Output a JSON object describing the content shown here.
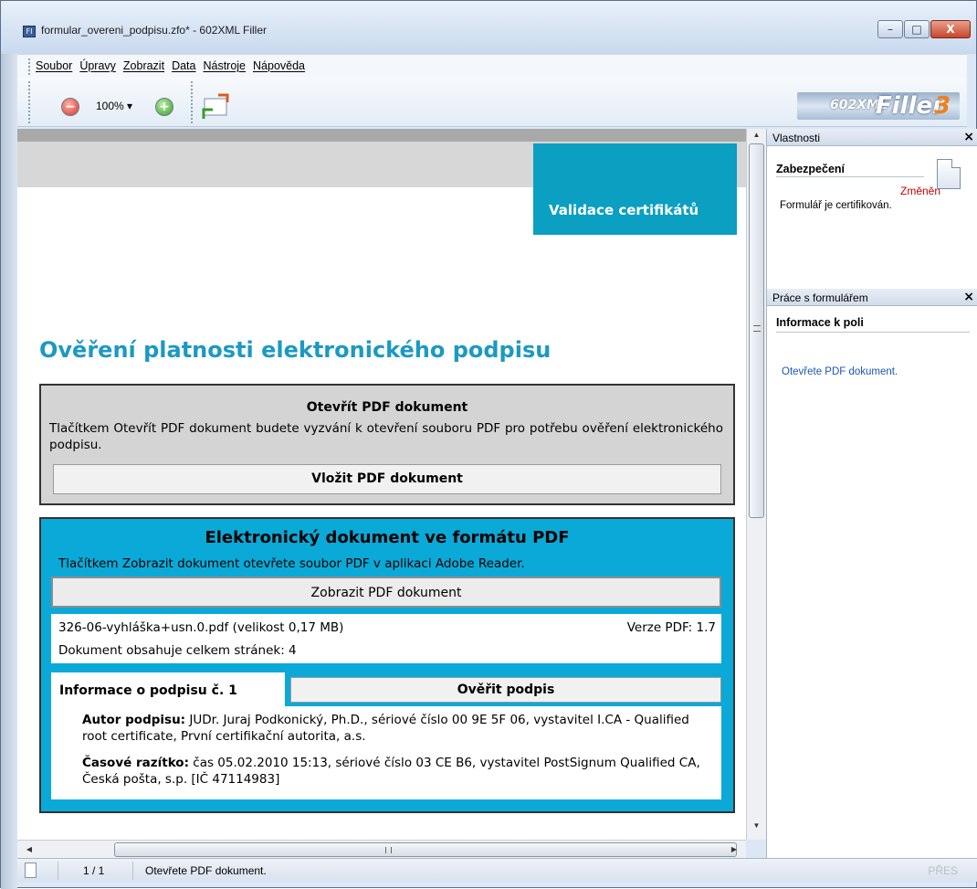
{
  "window": {
    "title": "formular_overeni_podpisu.zfo* - 602XML Filler",
    "app_icon": "FI",
    "controls": {
      "minimize": "–",
      "maximize": "□",
      "close": "X"
    }
  },
  "menu": [
    "Soubor",
    "Úpravy",
    "Zobrazit",
    "Data",
    "Nástroje",
    "Nápověda"
  ],
  "toolbar": {
    "zoom_out_icon": "zoom-out-icon",
    "zoom_value": "100% ▾",
    "zoom_in_icon": "zoom-in-icon",
    "logo": {
      "part1": "602XML",
      "part2": "Filler",
      "part3": "3"
    }
  },
  "document": {
    "header_badge": "Validace certifikátů",
    "title": "Ověření platnosti elektronického podpisu",
    "open_section": {
      "heading": "Otevřít PDF dokument",
      "text": "Tlačítkem Otevřít PDF dokument budete vyzvání k otevření souboru PDF pro potřebu ověření elektronického podpisu.",
      "button": "Vložit PDF dokument"
    },
    "pdf_section": {
      "heading": "Elektronický dokument ve formátu PDF",
      "text": "Tlačítkem Zobrazit dokument otevřete soubor PDF v aplikaci Adobe Reader.",
      "button": "Zobrazit PDF dokument",
      "file": "326-06-vyhláška+usn.0.pdf (velikost 0,17 MB)",
      "version": "Verze PDF: 1.7",
      "pages": "Dokument obsahuje celkem stránek: 4",
      "signature_tab": "Informace o podpisu č. 1",
      "verify_button": "Ověřit podpis",
      "author_label": "Autor podpisu:",
      "author_value": " JUDr. Juraj Podkonický, Ph.D., sériové číslo 00 9E 5F 06, vystavitel I.CA - Qualified root certificate, První certifikační autorita, a.s.",
      "timestamp_label": "Časové razítko:",
      "timestamp_value": " čas 05.02.2010 15:13, sériové číslo 03 CE B6, vystavitel PostSignum Qualified CA, Česká pošta, s.p. [IČ 47114983]"
    }
  },
  "panels": {
    "properties": {
      "title": "Vlastnosti",
      "close": "×",
      "section": "Zabezpečení",
      "changed": "Změněn",
      "status": "Formulář je certifikován."
    },
    "form_work": {
      "title": "Práce s formulářem",
      "close": "×",
      "section": "Informace k poli",
      "info": "Otevřete PDF dokument."
    }
  },
  "scrollbars": {
    "grip_h": "III",
    "up": "▲",
    "down": "▼",
    "left": "◀",
    "right": "▶",
    "splitter": "≡"
  },
  "statusbar": {
    "page": "1 / 1",
    "message": "Otevřete PDF dokument.",
    "mode": "PŘES"
  },
  "colors": {
    "accent": "#0b9fc1",
    "title": "#1c99c2",
    "pdf_box": "#0aa9d7",
    "changed": "#c00000"
  }
}
